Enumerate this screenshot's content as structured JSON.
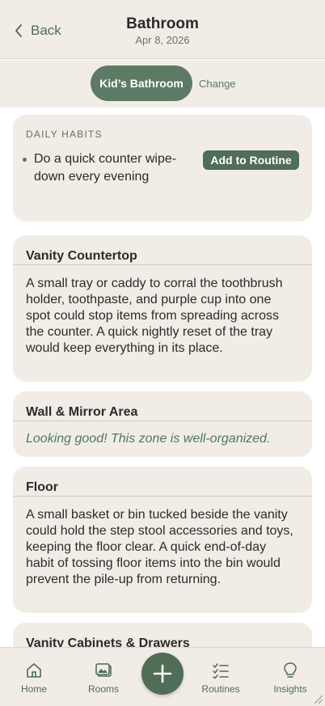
{
  "header": {
    "back_label": "Back",
    "title": "Bathroom",
    "date": "Apr 8, 2026"
  },
  "room_selector": {
    "selected": "Kid’s Bathroom",
    "change_label": "Change"
  },
  "daily_habits": {
    "label": "DAILY HABITS",
    "items": [
      {
        "text": "Do a quick counter wipe-down every evening",
        "action_label": "Add to Routine"
      }
    ]
  },
  "zones": [
    {
      "title": "Vanity Countertop",
      "body": "A small tray or caddy to corral the toothbrush holder, toothpaste, and purple cup into one spot could stop items from spreading across the counter. A quick nightly reset of the tray would keep everything in its place."
    },
    {
      "title": "Wall & Mirror Area",
      "status": "Looking good! This zone is well-organized."
    },
    {
      "title": "Floor",
      "body": "A small basket or bin tucked beside the vanity could hold the step stool accessories and toys, keeping the floor clear. A quick end-of-day habit of tossing floor items into the bin would prevent the pile-up from returning."
    },
    {
      "title": "Vanity Cabinets & Drawers"
    }
  ],
  "nav": {
    "items": [
      {
        "label": "Home",
        "icon": "home-icon"
      },
      {
        "label": "Rooms",
        "icon": "rooms-icon"
      },
      {
        "label": "Routines",
        "icon": "routines-icon"
      },
      {
        "label": "Insights",
        "icon": "lightbulb-icon"
      }
    ],
    "fab_icon": "plus-icon"
  },
  "colors": {
    "accent": "#4f6d57",
    "pill": "#5c7a64",
    "card_bg": "#f1ede6",
    "good_text": "#4e7a56"
  }
}
